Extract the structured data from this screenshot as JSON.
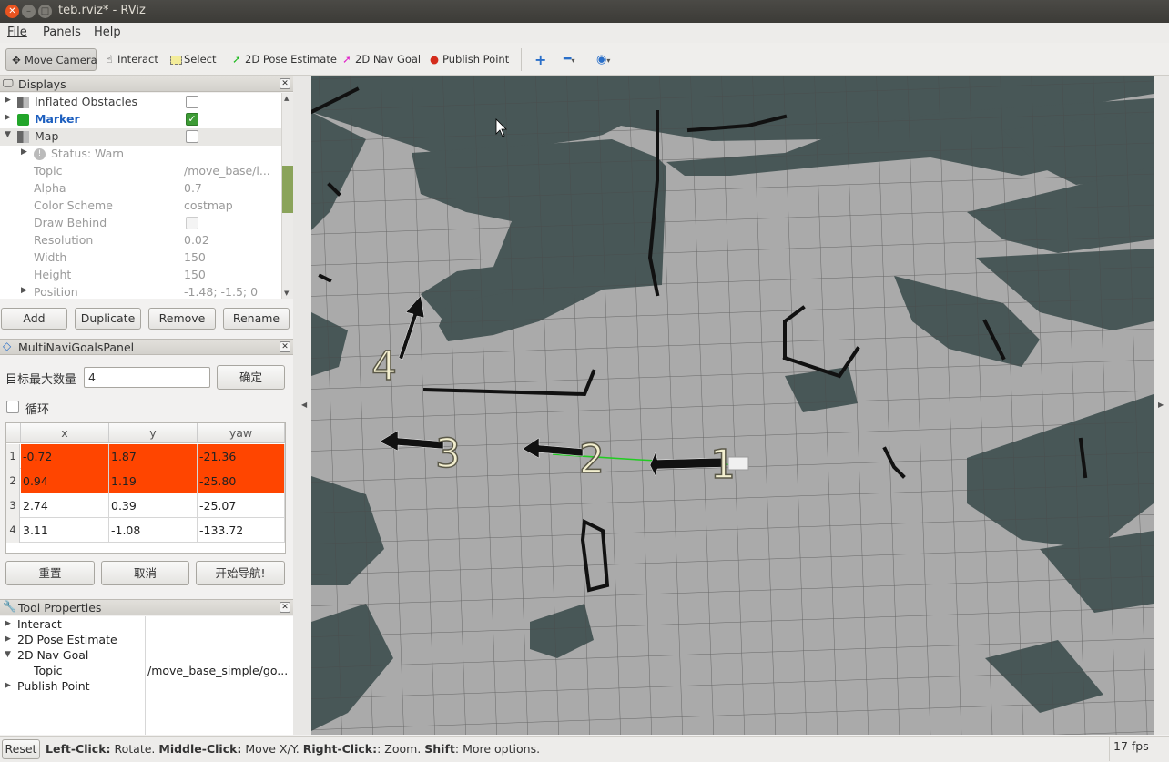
{
  "window": {
    "title": "teb.rviz* - RViz"
  },
  "menu": {
    "file": "File",
    "panels": "Panels",
    "help": "Help"
  },
  "toolbar": {
    "move_camera": "Move Camera",
    "interact": "Interact",
    "select": "Select",
    "pose_estimate": "2D Pose Estimate",
    "nav_goal": "2D Nav Goal",
    "publish_point": "Publish Point"
  },
  "displays": {
    "title": "Displays",
    "items": [
      {
        "label": "Inflated Obstacles",
        "checked": false
      },
      {
        "label": "Marker",
        "checked": true
      },
      {
        "label": "Map",
        "checked": false
      }
    ],
    "map_props": [
      {
        "label": "Status: Warn",
        "value": ""
      },
      {
        "label": "Topic",
        "value": "/move_base/l..."
      },
      {
        "label": "Alpha",
        "value": "0.7"
      },
      {
        "label": "Color Scheme",
        "value": "costmap"
      },
      {
        "label": "Draw Behind",
        "value": ""
      },
      {
        "label": "Resolution",
        "value": "0.02"
      },
      {
        "label": "Width",
        "value": "150"
      },
      {
        "label": "Height",
        "value": "150"
      },
      {
        "label": "Position",
        "value": "-1.48; -1.5; 0"
      }
    ],
    "buttons": {
      "add": "Add",
      "duplicate": "Duplicate",
      "remove": "Remove",
      "rename": "Rename"
    }
  },
  "goals_panel": {
    "title": "MultiNaviGoalsPanel",
    "max_label": "目标最大数量",
    "max_value": "4",
    "confirm": "确定",
    "loop_label": "循环",
    "columns": [
      "x",
      "y",
      "yaw"
    ],
    "rows": [
      {
        "n": "1",
        "x": "-0.72",
        "y": "1.87",
        "yaw": "-21.36",
        "selected": true
      },
      {
        "n": "2",
        "x": "0.94",
        "y": "1.19",
        "yaw": "-25.80",
        "selected": true
      },
      {
        "n": "3",
        "x": "2.74",
        "y": "0.39",
        "yaw": "-25.07",
        "selected": false
      },
      {
        "n": "4",
        "x": "3.11",
        "y": "-1.08",
        "yaw": "-133.72",
        "selected": false
      }
    ],
    "reset": "重置",
    "cancel": "取消",
    "start": "开始导航!"
  },
  "tool_properties": {
    "title": "Tool Properties",
    "items": [
      {
        "label": "Interact",
        "value": ""
      },
      {
        "label": "2D Pose Estimate",
        "value": ""
      },
      {
        "label": "2D Nav Goal",
        "value": ""
      },
      {
        "label": "Topic",
        "value": "/move_base_simple/go..."
      },
      {
        "label": "Publish Point",
        "value": ""
      }
    ]
  },
  "viewport": {
    "goal_labels": [
      "1",
      "2",
      "3",
      "4"
    ],
    "map_dark": "#485757",
    "map_light": "#aaaaaa",
    "selection_color": "#ff4500"
  },
  "status": {
    "reset": "Reset",
    "lc_key": "Left-Click:",
    "lc_val": " Rotate. ",
    "mc_key": "Middle-Click:",
    "mc_val": " Move X/Y. ",
    "rc_key": "Right-Click:",
    "rc_val": ": Zoom. ",
    "shift_key": "Shift",
    "shift_val": ": More options.",
    "fps": "17 fps"
  }
}
